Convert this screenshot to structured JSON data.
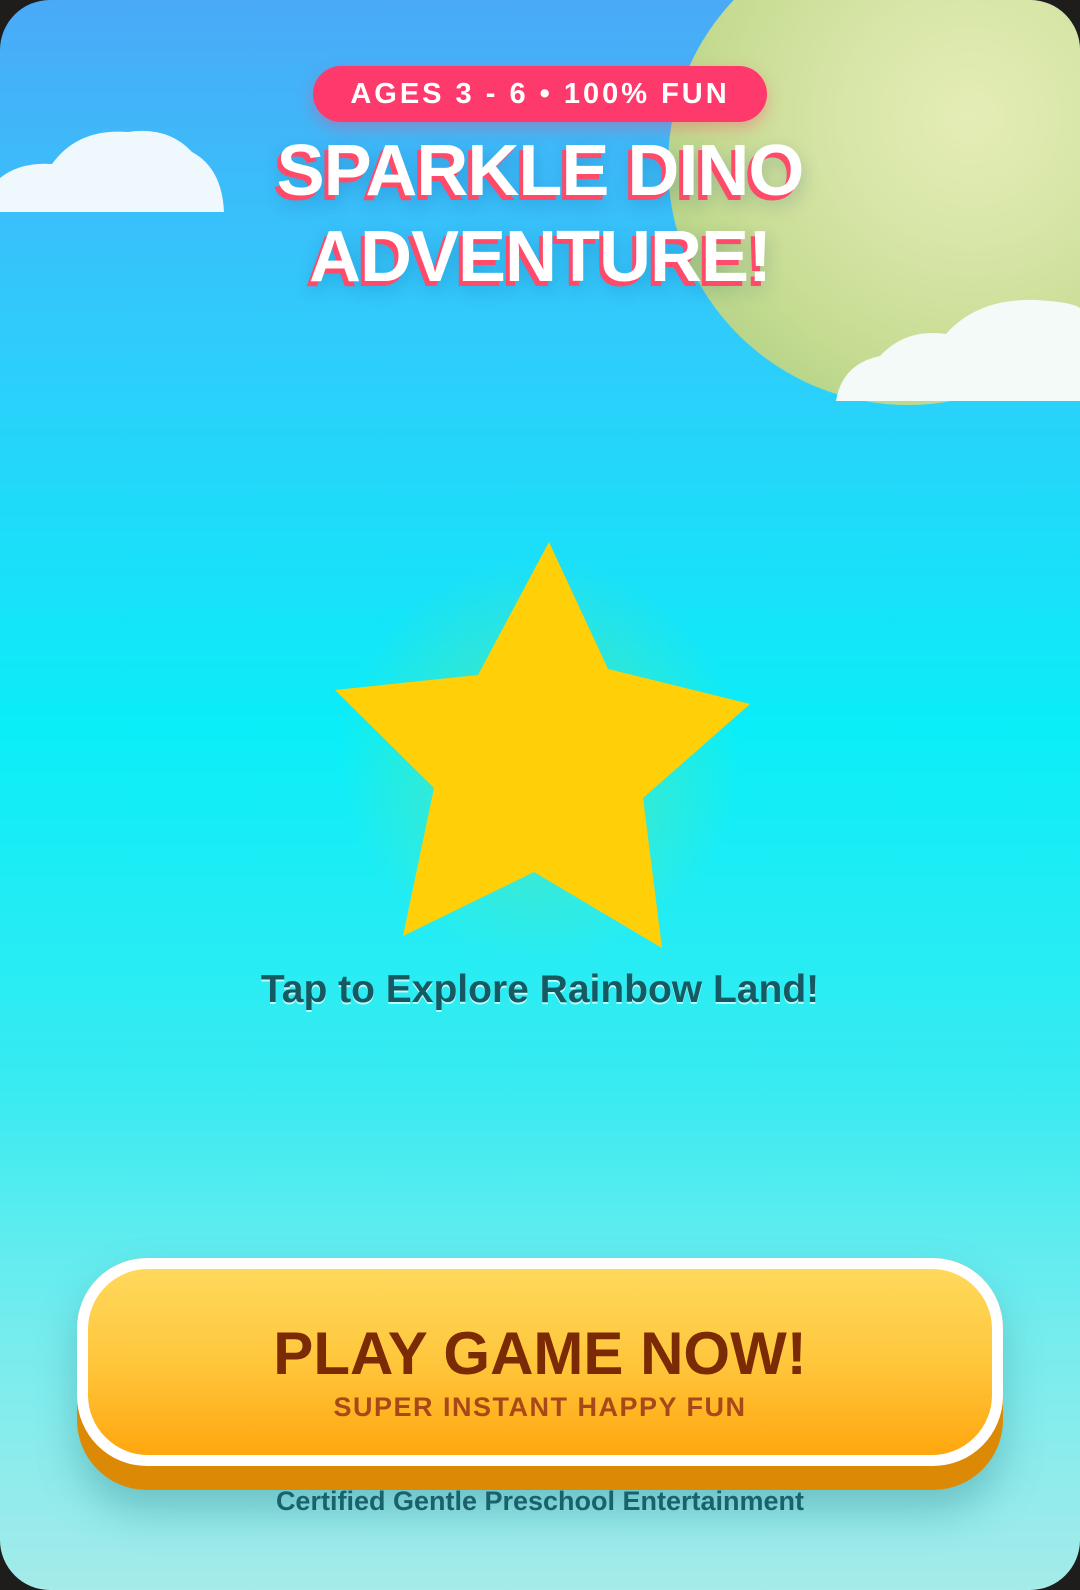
{
  "header": {
    "badge": "AGES 3 - 6 • 100% FUN",
    "title_line1": "SPARKLE DINO",
    "title_line2": "ADVENTURE!"
  },
  "main": {
    "center_icon": "star-icon",
    "tap_prompt": "Tap to Explore Rainbow Land!"
  },
  "cta": {
    "label": "PLAY GAME NOW!",
    "sublabel": "SUPER INSTANT HAPPY FUN"
  },
  "footer": {
    "text": "Certified Gentle Preschool Entertainment"
  },
  "colors": {
    "badge": "#fe3a6c",
    "title_shadow": "#ff4a6a",
    "star": "#ffd007",
    "button_top": "#ffd95c",
    "button_bottom": "#ffa70e",
    "button_text": "#7a2a05",
    "sky_top": "#4aaaf8",
    "sky_mid": "#0aeef8"
  }
}
